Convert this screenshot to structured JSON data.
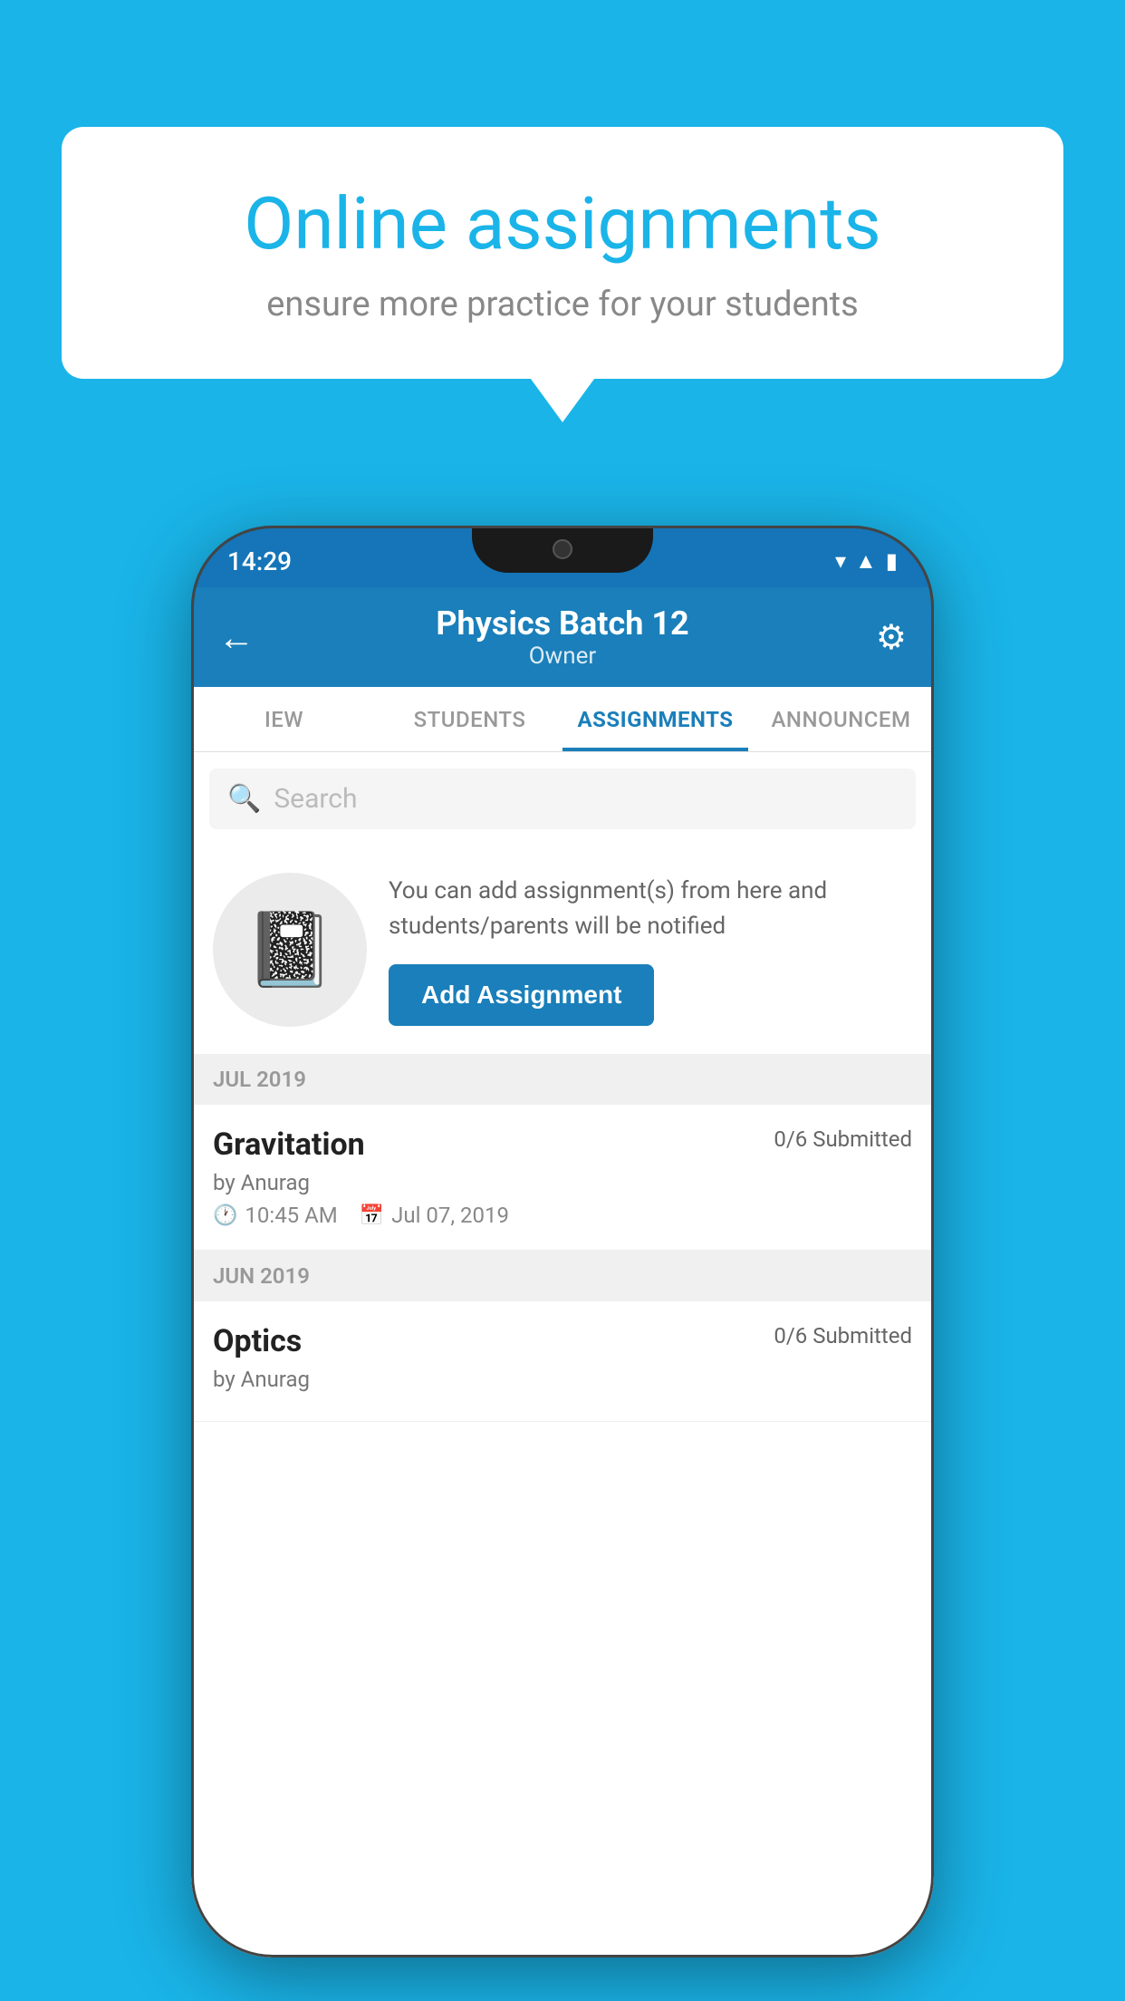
{
  "background_color": "#1ab4e8",
  "speech_bubble": {
    "title": "Online assignments",
    "subtitle": "ensure more practice for your students"
  },
  "phone": {
    "status_bar": {
      "time": "14:29"
    },
    "header": {
      "title": "Physics Batch 12",
      "subtitle": "Owner",
      "back_label": "←",
      "settings_label": "⚙"
    },
    "tabs": [
      {
        "label": "IEW",
        "active": false
      },
      {
        "label": "STUDENTS",
        "active": false
      },
      {
        "label": "ASSIGNMENTS",
        "active": true
      },
      {
        "label": "ANNOUNCEM",
        "active": false
      }
    ],
    "search": {
      "placeholder": "Search"
    },
    "promo": {
      "description": "You can add assignment(s) from here and students/parents will be notified",
      "button_label": "Add Assignment"
    },
    "sections": [
      {
        "header": "JUL 2019",
        "assignments": [
          {
            "title": "Gravitation",
            "submitted": "0/6 Submitted",
            "author": "by Anurag",
            "time": "10:45 AM",
            "date": "Jul 07, 2019"
          }
        ]
      },
      {
        "header": "JUN 2019",
        "assignments": [
          {
            "title": "Optics",
            "submitted": "0/6 Submitted",
            "author": "by Anurag",
            "time": "",
            "date": ""
          }
        ]
      }
    ]
  }
}
